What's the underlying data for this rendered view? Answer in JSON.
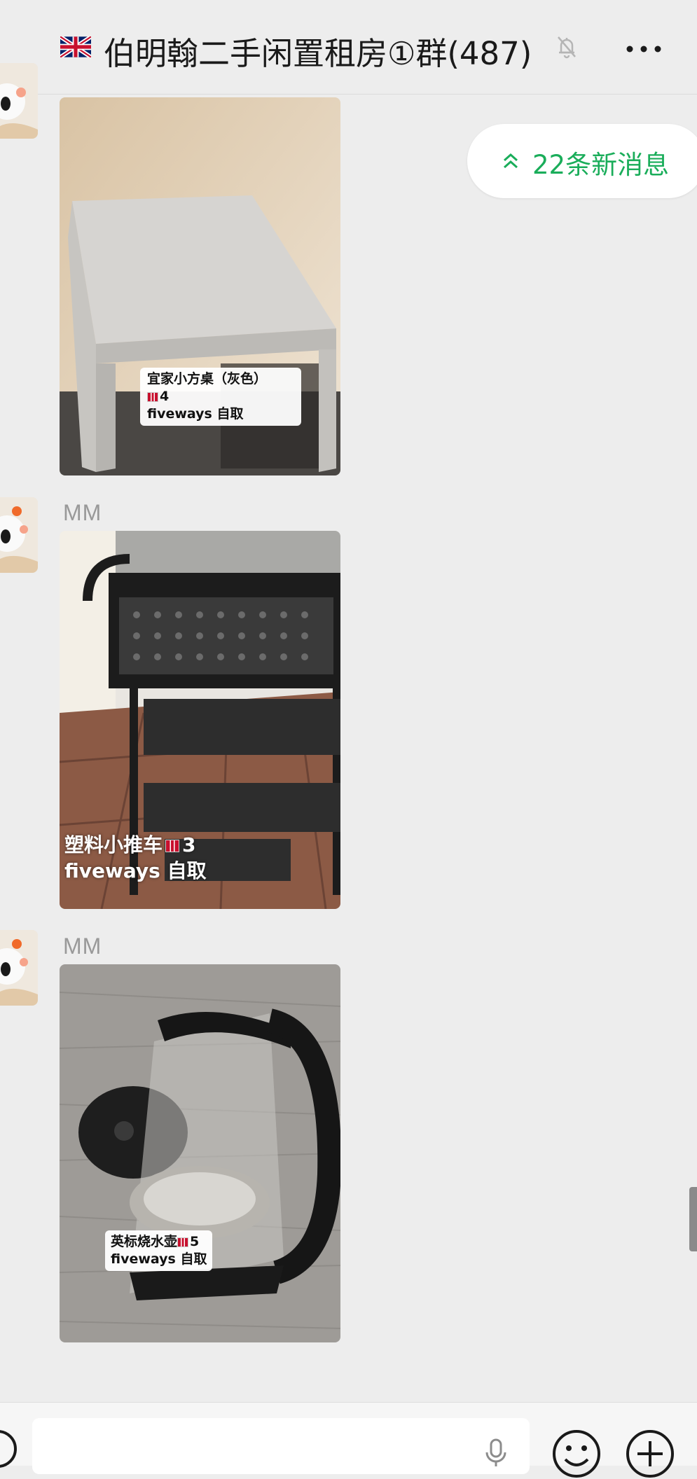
{
  "header": {
    "title": "伯明翰二手闲置租房①群(487)",
    "flag_icon": "uk-flag-icon",
    "mute_icon": "bell-muted-icon",
    "more_icon": "more-dots-icon"
  },
  "new_messages": {
    "label": "22条新消息",
    "icon": "double-chevron-up-icon",
    "color": "#1aad5a"
  },
  "messages": [
    {
      "sender": "",
      "caption": {
        "line1": "宜家小方桌（灰色）",
        "line2": "4",
        "line3": "fiveways 自取"
      }
    },
    {
      "sender": "MM",
      "caption": {
        "line1": "塑料小推车",
        "line1_num": "3",
        "line2": "fiveways 自取"
      }
    },
    {
      "sender": "MM",
      "caption": {
        "line1": "英标烧水壶",
        "line1_num": "5",
        "line2": "fiveways 自取"
      }
    }
  ],
  "input_bar": {
    "voice_icon": "voice-icon",
    "mic_icon": "microphone-icon",
    "emoji_icon": "emoji-icon",
    "plus_icon": "plus-circle-icon"
  }
}
